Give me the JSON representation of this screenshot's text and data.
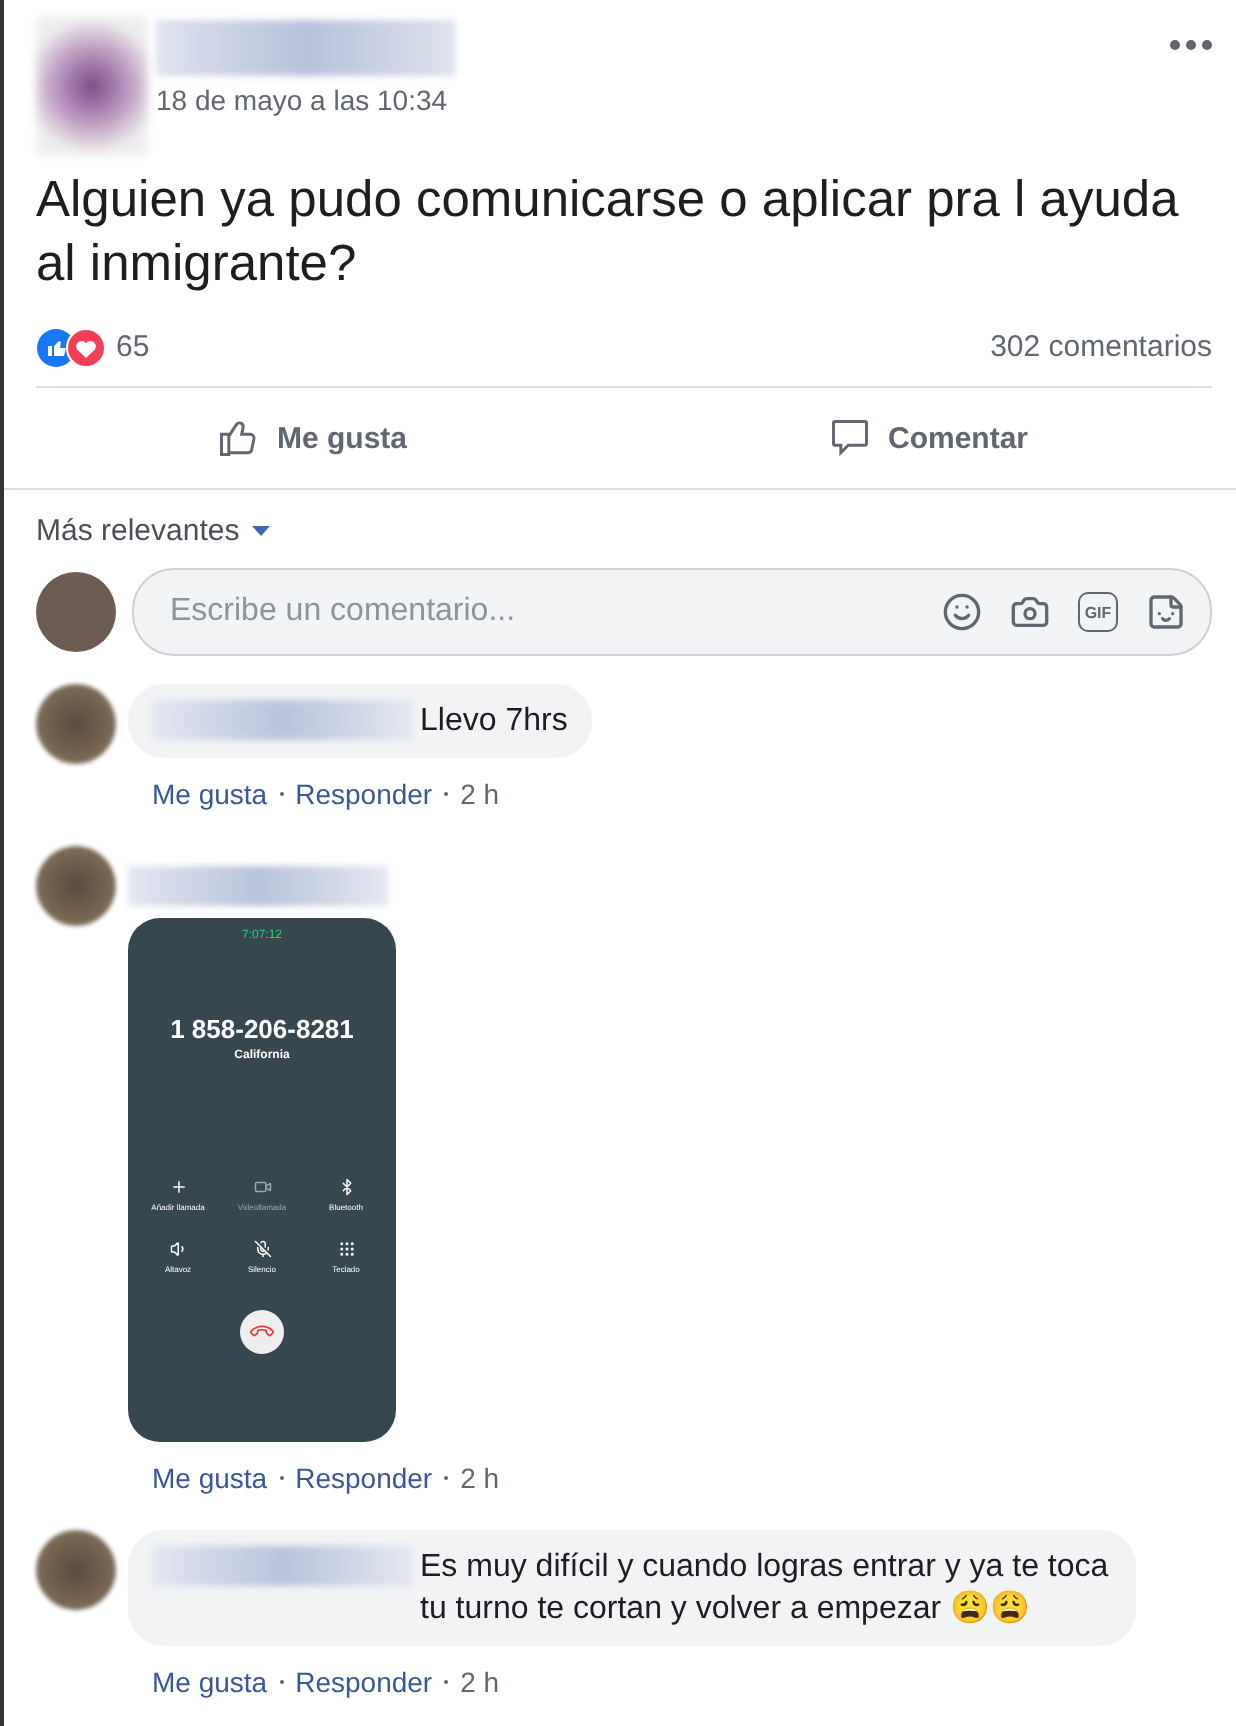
{
  "post": {
    "timestamp": "18 de mayo a las 10:34",
    "text": "Alguien ya pudo comunicarse o aplicar pra l ayuda al inmigrante?",
    "reaction_count": "65",
    "comment_count": "302 comentarios"
  },
  "actions": [
    {
      "label": "Me gusta",
      "kind": "like"
    },
    {
      "label": "Comentar",
      "kind": "comment"
    }
  ],
  "sort": {
    "label": "Más relevantes"
  },
  "composer": {
    "placeholder": "Escribe un comentario...",
    "gif_label": "GIF"
  },
  "comments": [
    {
      "kind": "text",
      "text": "Llevo 7hrs",
      "actions": [
        "Me gusta",
        "Responder"
      ],
      "time": "2 h"
    },
    {
      "kind": "image",
      "call": {
        "timer": "7:07:12",
        "number": "1 858-206-8281",
        "location": "California",
        "buttons": [
          {
            "label": "Añadir llamada",
            "disabled": false
          },
          {
            "label": "Videollamada",
            "disabled": true
          },
          {
            "label": "Bluetooth",
            "disabled": false
          },
          {
            "label": "Altavoz",
            "disabled": false
          },
          {
            "label": "Silencio",
            "disabled": false
          },
          {
            "label": "Teclado",
            "disabled": false
          }
        ]
      },
      "actions": [
        "Me gusta",
        "Responder"
      ],
      "time": "2 h"
    },
    {
      "kind": "text",
      "text": "Es muy difícil y cuando logras entrar y ya te toca tu turno te cortan y volver a empezar 😩😩",
      "actions": [
        "Me gusta",
        "Responder"
      ],
      "time": "2 h"
    }
  ]
}
